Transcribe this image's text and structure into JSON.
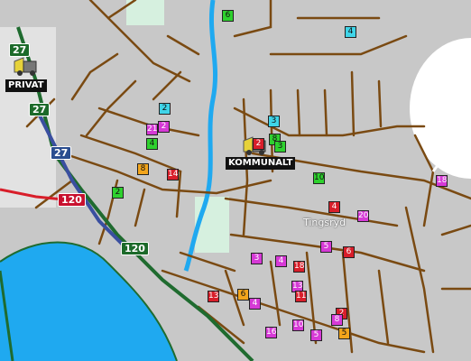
{
  "map": {
    "colors": {
      "land": "#c8c8c8",
      "water": "#1fa9f0",
      "park": "#cfeedd",
      "road": "#7a4a12",
      "highway_green": "#1f6b2f",
      "highway_blue": "#3a4fa0",
      "highway_red": "#d81e2a"
    },
    "town_label": "Tingsryd",
    "vehicles": [
      {
        "label": "PRIVAT",
        "icon": "truck-icon"
      },
      {
        "label": "KOMMUNALT",
        "icon": "truck-icon"
      }
    ],
    "road_shields": [
      {
        "text": "27",
        "color": "green"
      },
      {
        "text": "27",
        "color": "green"
      },
      {
        "text": "27",
        "color": "blue"
      },
      {
        "text": "120",
        "color": "red"
      },
      {
        "text": "120",
        "color": "green"
      }
    ],
    "markers": [
      {
        "text": "6",
        "color": "green"
      },
      {
        "text": "4",
        "color": "cyan"
      },
      {
        "text": "2",
        "color": "cyan"
      },
      {
        "text": "2",
        "color": "magenta"
      },
      {
        "text": "21",
        "color": "magenta"
      },
      {
        "text": "4",
        "color": "green"
      },
      {
        "text": "3",
        "color": "cyan"
      },
      {
        "text": "2",
        "color": "red"
      },
      {
        "text": "8",
        "color": "green"
      },
      {
        "text": "3",
        "color": "green"
      },
      {
        "text": "8",
        "color": "orange"
      },
      {
        "text": "14",
        "color": "red"
      },
      {
        "text": "2",
        "color": "green"
      },
      {
        "text": "10",
        "color": "green"
      },
      {
        "text": "4",
        "color": "red"
      },
      {
        "text": "18",
        "color": "magenta"
      },
      {
        "text": "20",
        "color": "magenta"
      },
      {
        "text": "5",
        "color": "magenta"
      },
      {
        "text": "6",
        "color": "red"
      },
      {
        "text": "3",
        "color": "magenta"
      },
      {
        "text": "4",
        "color": "magenta"
      },
      {
        "text": "18",
        "color": "red"
      },
      {
        "text": "13",
        "color": "magenta"
      },
      {
        "text": "11",
        "color": "red"
      },
      {
        "text": "13",
        "color": "red"
      },
      {
        "text": "6",
        "color": "orange"
      },
      {
        "text": "4",
        "color": "magenta"
      },
      {
        "text": "2",
        "color": "red"
      },
      {
        "text": "8",
        "color": "magenta"
      },
      {
        "text": "5",
        "color": "orange"
      },
      {
        "text": "16",
        "color": "magenta"
      },
      {
        "text": "10",
        "color": "magenta"
      },
      {
        "text": "5",
        "color": "magenta"
      }
    ]
  }
}
